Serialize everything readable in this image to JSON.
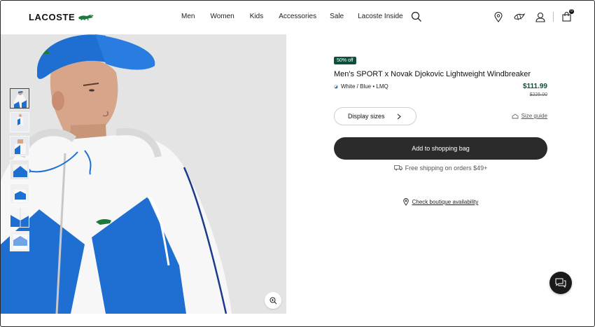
{
  "header": {
    "logo_text": "LACOSTE",
    "nav": [
      "Men",
      "Women",
      "Kids",
      "Accessories",
      "Sale",
      "Lacoste Inside"
    ],
    "icons": [
      "search-icon",
      "store-locator-icon",
      "loyalty-icon",
      "account-icon",
      "bag-icon"
    ],
    "bag_count": "0"
  },
  "gallery": {
    "thumbnail_count": 7,
    "active_thumbnail": 1,
    "zoom_icon": "zoom-icon"
  },
  "product": {
    "discount_badge": "50% off",
    "title": "Men's SPORT x Novak Djokovic Lightweight Windbreaker",
    "color_label": "White / Blue • LMQ",
    "price": "$111.99",
    "old_price": "$225.00",
    "sizes_button": "Display sizes",
    "size_guide": "Size guide",
    "add_to_bag": "Add to shopping bag",
    "shipping": "Free shipping on orders $49+",
    "boutique_link": "Check boutique availability"
  },
  "colors": {
    "brand_green": "#0d4f3c",
    "jacket_blue": "#1e6fd1",
    "button_dark": "#2b2b2b"
  },
  "chat": {
    "icon": "chat-icon"
  }
}
